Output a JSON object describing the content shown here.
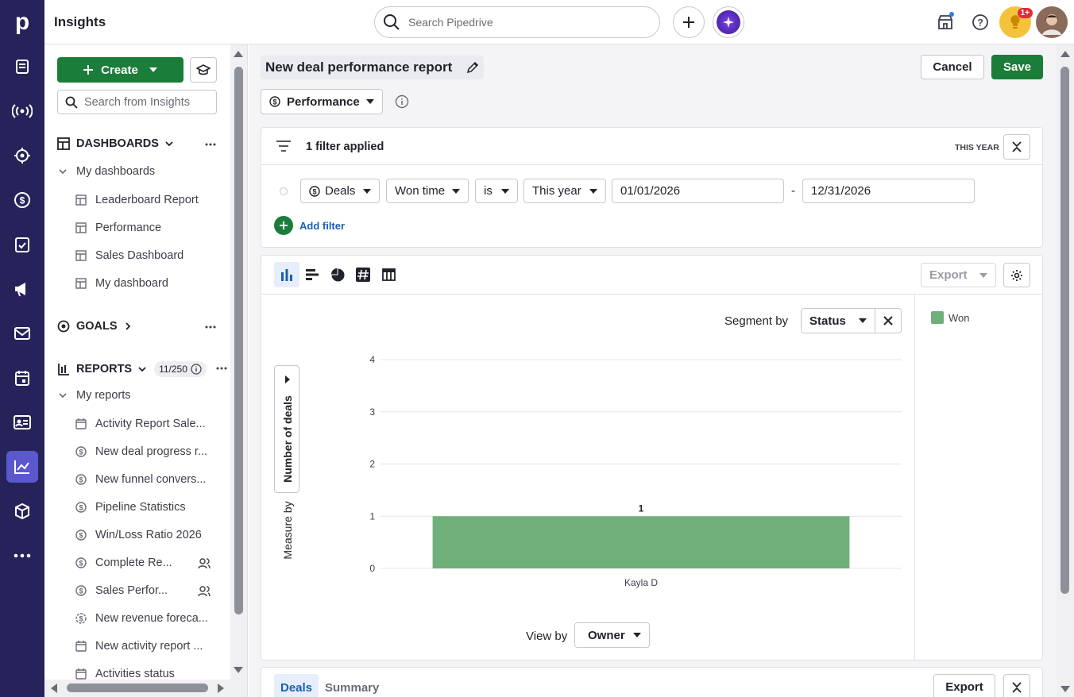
{
  "app": {
    "title": "Insights",
    "search_placeholder": "Search Pipedrive",
    "notification_badge": "1+"
  },
  "sidebar": {
    "create_label": "Create",
    "search_placeholder": "Search from Insights",
    "dashboards": {
      "title": "DASHBOARDS",
      "group": "My dashboards",
      "items": [
        "Leaderboard Report",
        "Performance",
        "Sales Dashboard",
        "My dashboard"
      ]
    },
    "goals": {
      "title": "GOALS"
    },
    "reports": {
      "title": "REPORTS",
      "count": "11/250",
      "group": "My reports",
      "items": [
        {
          "label": "Activity Report Sale...",
          "icon": "calendar-icon"
        },
        {
          "label": "New deal progress r...",
          "icon": "dollar-icon"
        },
        {
          "label": "New funnel convers...",
          "icon": "dollar-icon"
        },
        {
          "label": "Pipeline Statistics",
          "icon": "dollar-icon"
        },
        {
          "label": "Win/Loss Ratio 2026",
          "icon": "dollar-icon"
        },
        {
          "label": "Complete Re...",
          "icon": "dollar-icon",
          "shared": true
        },
        {
          "label": "Sales Perfor...",
          "icon": "dollar-icon",
          "shared": true
        },
        {
          "label": "New revenue foreca...",
          "icon": "forecast-icon"
        },
        {
          "label": "New activity report ...",
          "icon": "calendar-icon"
        },
        {
          "label": "Activities status",
          "icon": "calendar-icon"
        }
      ]
    }
  },
  "report": {
    "title": "New deal performance report",
    "cancel_label": "Cancel",
    "save_label": "Save",
    "type_label": "Performance",
    "filter": {
      "summary": "1 filter applied",
      "period_tag": "THIS YEAR",
      "entity": "Deals",
      "field": "Won time",
      "operator": "is",
      "period": "This year",
      "date_from": "01/01/2026",
      "date_sep": "-",
      "date_to": "12/31/2026",
      "add_label": "Add filter"
    },
    "chart": {
      "export_label": "Export",
      "segment_label": "Segment by",
      "segment_value": "Status",
      "measure_label": "Measure by",
      "measure_value": "Number of deals",
      "view_label": "View by",
      "view_value": "Owner",
      "legend": [
        {
          "name": "Won",
          "color": "#6fb07a"
        }
      ]
    },
    "bottom": {
      "tabs": [
        "Deals",
        "Summary"
      ],
      "export_label": "Export"
    }
  },
  "chart_data": {
    "type": "bar",
    "categories": [
      "Kayla D"
    ],
    "series": [
      {
        "name": "Won",
        "values": [
          1
        ],
        "color": "#6fb07a"
      }
    ],
    "data_labels": [
      "1"
    ],
    "yticks": [
      "0",
      "1",
      "2",
      "3",
      "4"
    ],
    "ylim": [
      0,
      4
    ],
    "xlabel": "",
    "ylabel": "Number of deals",
    "grid": true,
    "legend": "right"
  }
}
